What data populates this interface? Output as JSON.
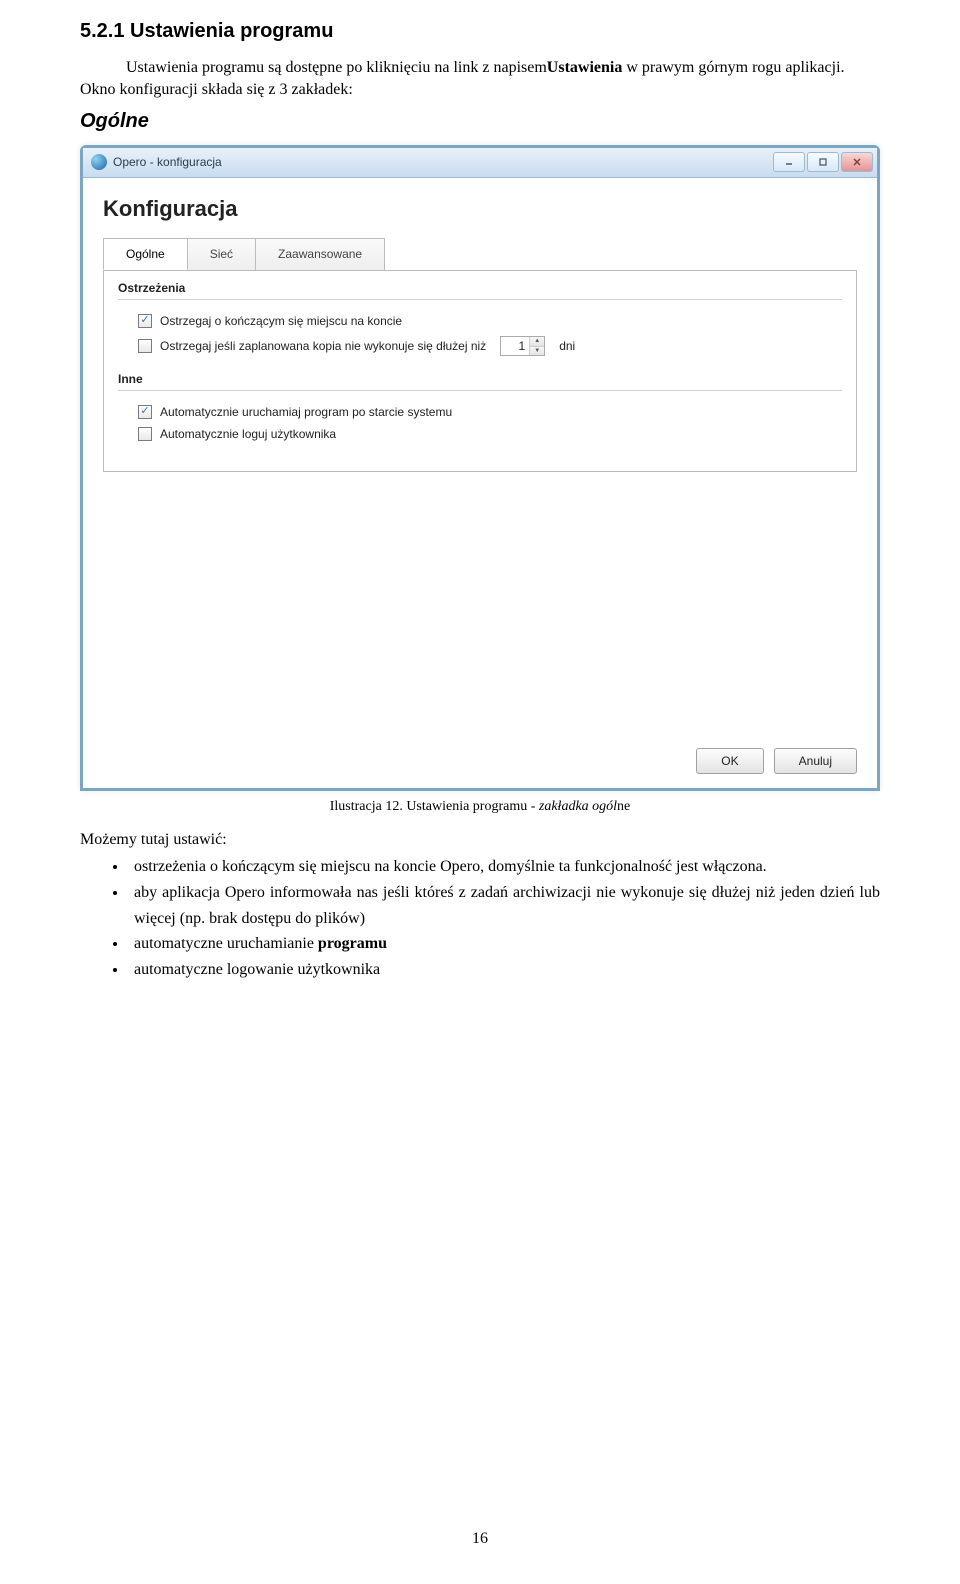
{
  "section_number": "5.2.1",
  "section_title": "Ustawienia programu",
  "intro": {
    "pre": "Ustawienia programu są dostępne po kliknięciu na link z napisem",
    "bold": "Ustawienia",
    "mid": " w prawym górnym rogu aplikacji. Okno konfiguracji składa się z 3 zakładek:"
  },
  "tab_section_title": "Ogólne",
  "window": {
    "title": "Opero - konfiguracja",
    "config_title": "Konfiguracja",
    "tabs": [
      "Ogólne",
      "Sieć",
      "Zaawansowane"
    ],
    "group_warnings": "Ostrzeżenia",
    "check_warn_space": "Ostrzegaj o kończącym się miejscu na koncie",
    "check_warn_planned": "Ostrzegaj jeśli zaplanowana kopia nie wykonuje się dłużej niż",
    "days_value": "1",
    "days_unit": "dni",
    "group_other": "Inne",
    "check_autostart": "Automatycznie uruchamiaj program po starcie systemu",
    "check_autologin": "Automatycznie loguj użytkownika",
    "btn_ok": "OK",
    "btn_cancel": "Anuluj"
  },
  "caption_pre": "Ilustracja 12. Ustawienia programu - ",
  "caption_italic": "zakładka ogól",
  "caption_post": "ne",
  "post": {
    "lead": "Możemy tutaj ustawić:",
    "bullet1": "ostrzeżenia o kończącym się miejscu na koncie Opero, domyślnie ta funkcjonalność jest włączona.",
    "bullet2": "aby aplikacja Opero informowała nas jeśli któreś z zadań archiwizacji nie wykonuje się dłużej niż jeden dzień lub więcej (np. brak dostępu do plików)",
    "bullet3_pre": "automatyczne uruchamianie ",
    "bullet3_bold": "programu",
    "bullet4": "automatyczne logowanie użytkownika"
  },
  "page_number": "16"
}
